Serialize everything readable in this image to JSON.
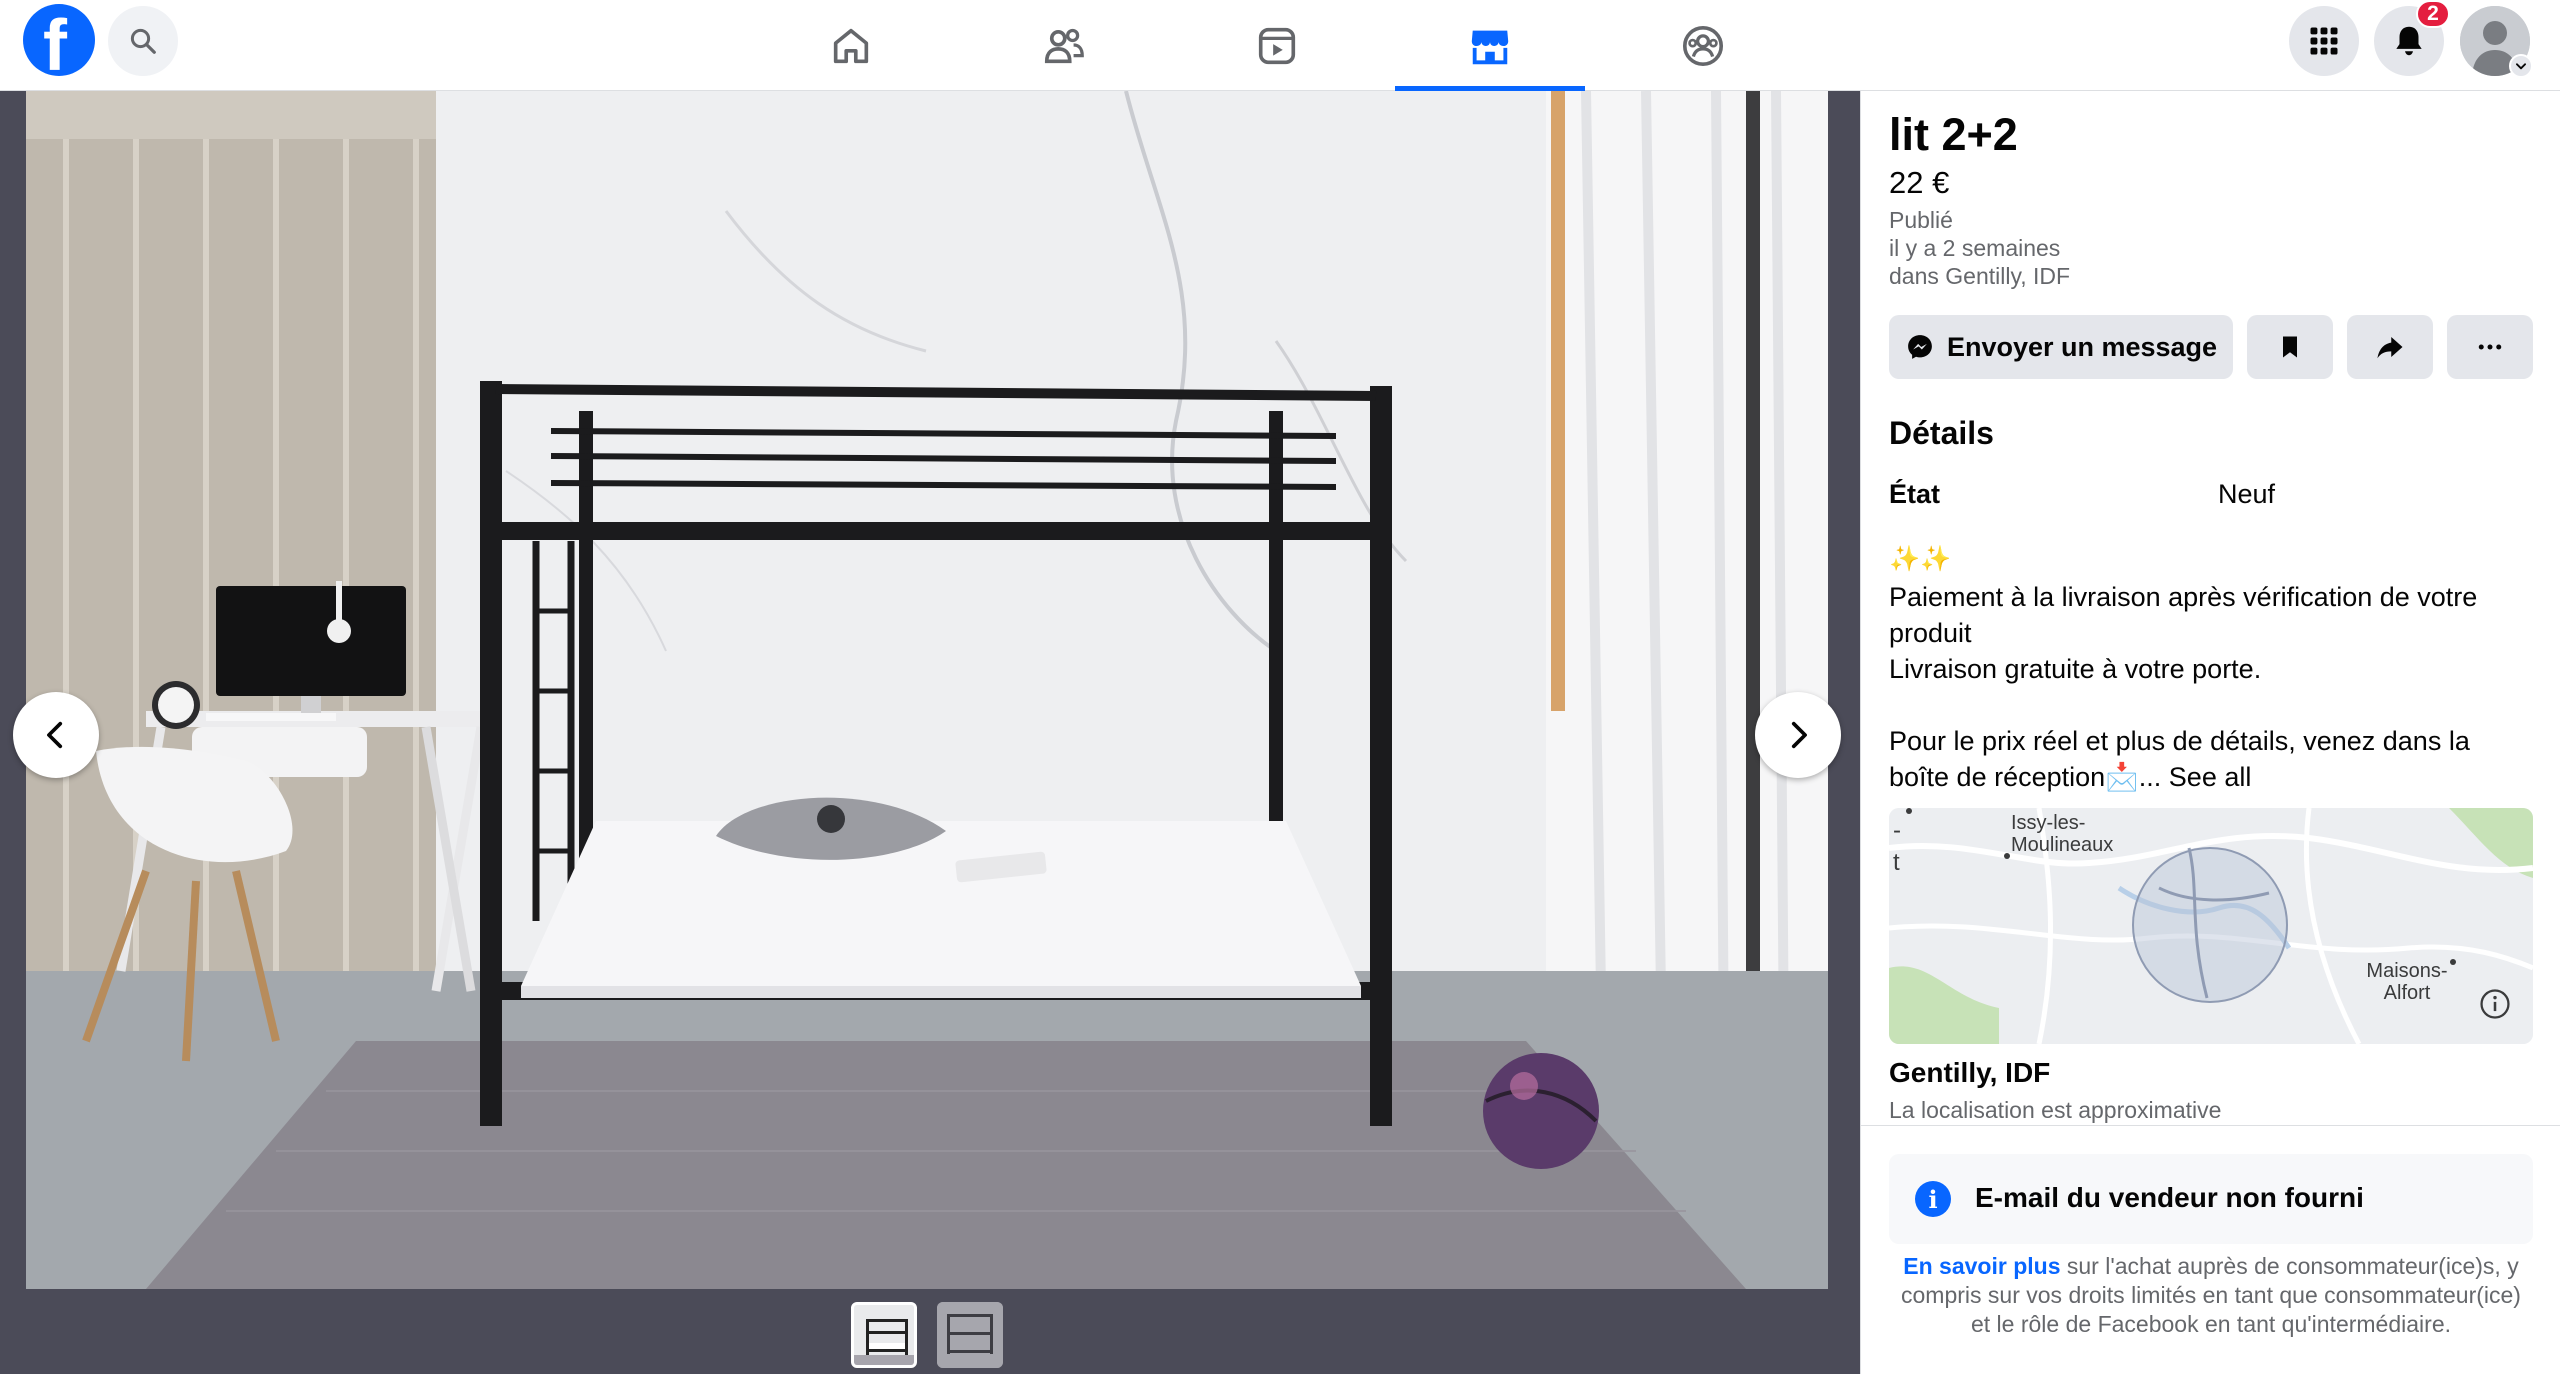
{
  "topbar": {
    "logo": "facebook-logo",
    "nav": [
      "home-icon",
      "friends-icon",
      "watch-icon",
      "marketplace-icon",
      "groups-icon"
    ],
    "active_tab": "marketplace-icon",
    "notifications_count": "2"
  },
  "listing": {
    "title": "lit 2+2",
    "price": "22 €",
    "published_label": "Publié",
    "published_time": "il y a 2 semaines",
    "published_place": "dans Gentilly, IDF",
    "message_button": "Envoyer un message",
    "details_title": "Détails",
    "condition_label": "État",
    "condition_value": "Neuf",
    "sparkles": "✨✨",
    "description_line1": "Paiement à la livraison après vérification de votre produit",
    "description_line2": "Livraison gratuite à votre porte.",
    "description_line3": "Pour le prix réel et plus de détails, venez dans la boîte de réception📩...",
    "see_all": "See all",
    "map_label_1": "Issy-les-Moulineaux",
    "map_label_2": "Maisons-Alfort",
    "location_title": "Gentilly, IDF",
    "location_note": "La localisation est approximative",
    "email_notice": "E-mail du vendeur non fourni",
    "learn_more": "En savoir plus",
    "legal_text": " sur l'achat auprès de consommateur(ice)s, y compris sur vos droits limités en tant que consommateur(ice) et le rôle de Facebook en tant qu'intermédiaire."
  },
  "viewer": {
    "photos": 2,
    "current_photo": 1
  },
  "colors": {
    "brand": "#0866ff",
    "badge": "#e41e3f"
  }
}
